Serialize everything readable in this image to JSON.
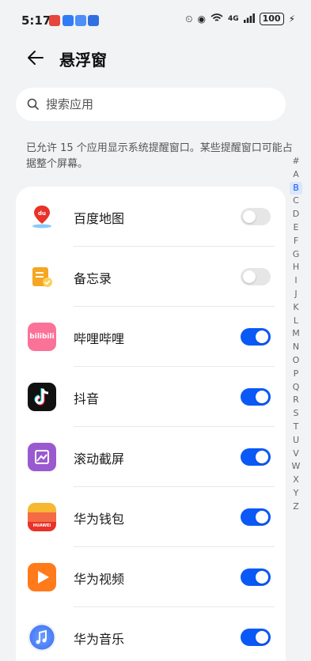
{
  "status_bar": {
    "time": "5:17",
    "network": "4G",
    "battery": "100",
    "notification_colors": [
      "#e5463d",
      "#2f7df6",
      "#4e8ef7",
      "#2f6fe0"
    ]
  },
  "header": {
    "title": "悬浮窗"
  },
  "search": {
    "placeholder": "搜索应用"
  },
  "description": "已允许 15 个应用显示系统提醒窗口。某些提醒窗口可能占据整个屏幕。",
  "apps": [
    {
      "label": "百度地图",
      "icon": "baidu-map-icon",
      "enabled": false,
      "color": "#ffffff"
    },
    {
      "label": "备忘录",
      "icon": "notepad-icon",
      "enabled": false,
      "color": "#f5a623"
    },
    {
      "label": "哔哩哔哩",
      "icon": "bilibili-icon",
      "enabled": true,
      "color": "#fb7299",
      "icon_text": "bilibili"
    },
    {
      "label": "抖音",
      "icon": "douyin-icon",
      "enabled": true,
      "color": "#111111"
    },
    {
      "label": "滚动截屏",
      "icon": "scroll-screenshot-icon",
      "enabled": true,
      "color": "#9b59d0"
    },
    {
      "label": "华为钱包",
      "icon": "huawei-wallet-icon",
      "enabled": true,
      "color": "#f04e2f",
      "icon_text": "HUAWEI"
    },
    {
      "label": "华为视频",
      "icon": "huawei-video-icon",
      "enabled": true,
      "color": "#ff7a1a"
    },
    {
      "label": "华为音乐",
      "icon": "huawei-music-icon",
      "enabled": true,
      "color": "#4a7cf7"
    }
  ],
  "index_letters": [
    "#",
    "A",
    "B",
    "C",
    "D",
    "E",
    "F",
    "G",
    "H",
    "I",
    "J",
    "K",
    "L",
    "M",
    "N",
    "O",
    "P",
    "Q",
    "R",
    "S",
    "T",
    "U",
    "V",
    "W",
    "X",
    "Y",
    "Z"
  ],
  "index_active": "B",
  "colors": {
    "accent": "#0a59f7",
    "background": "#f1f3f5"
  }
}
